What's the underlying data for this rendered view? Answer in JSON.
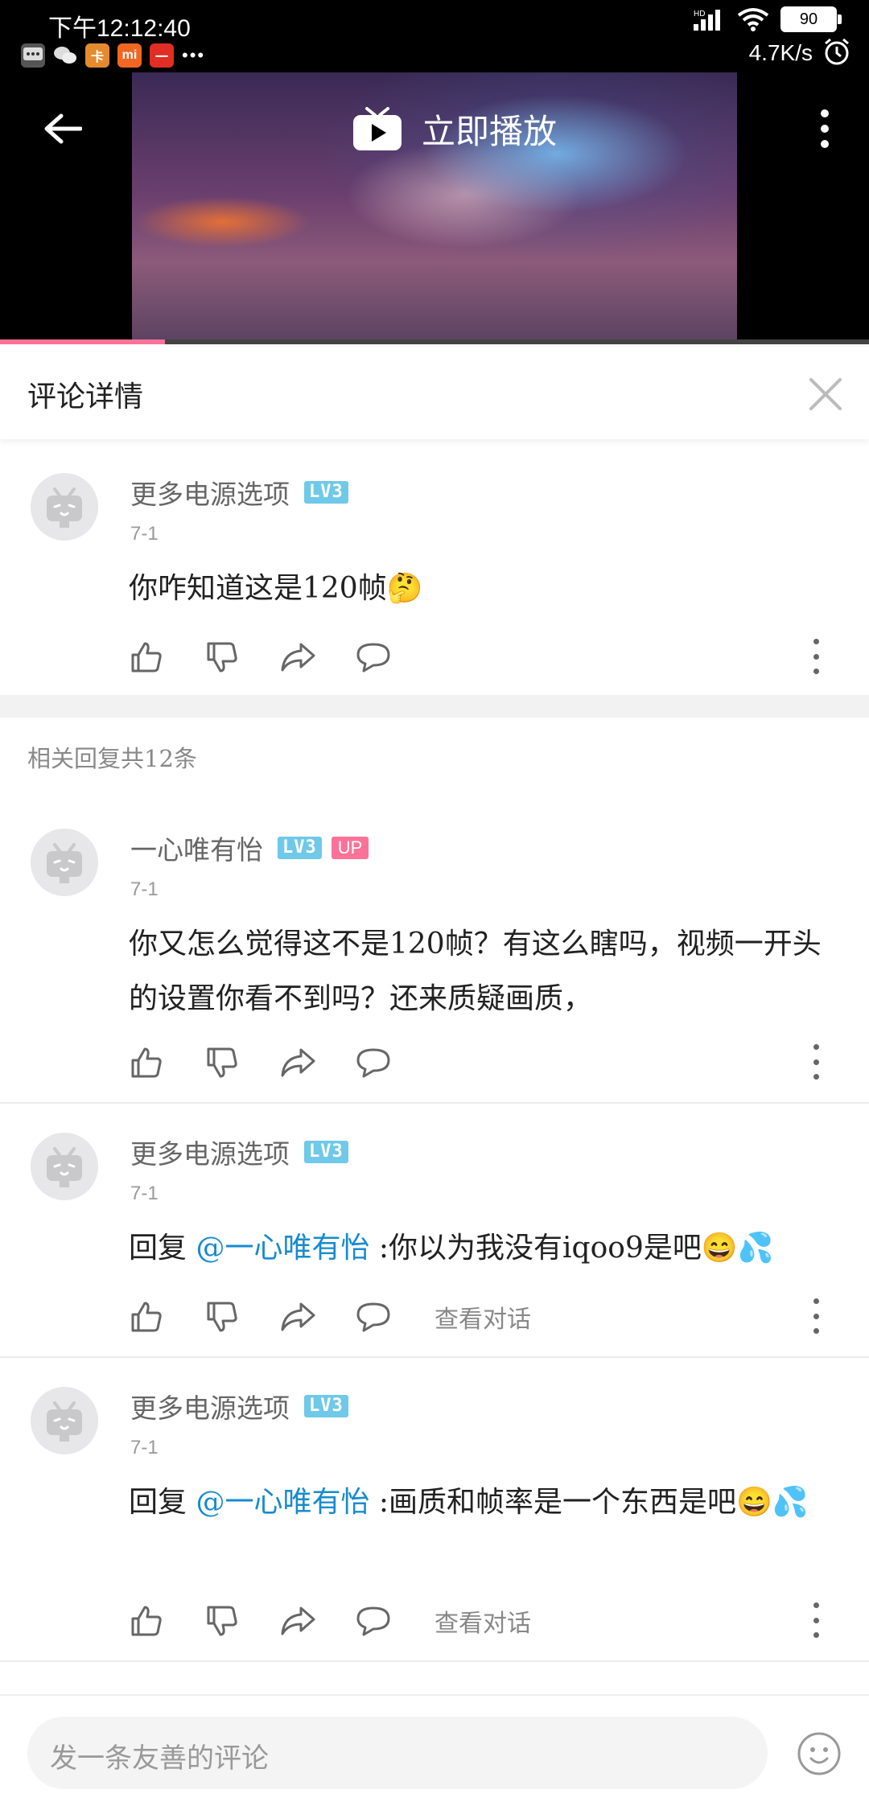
{
  "status_bar": {
    "time": "下午12:12:40",
    "speed": "4.7K/s",
    "battery": "90",
    "app_icons": [
      {
        "name": "message",
        "color": "#444444",
        "glyph": "…"
      },
      {
        "name": "wechat",
        "color": "#444444",
        "glyph": "◎"
      },
      {
        "name": "app-orange",
        "color": "#e68a2e",
        "glyph": "卡"
      },
      {
        "name": "mi",
        "color": "#f06723",
        "glyph": "mi"
      },
      {
        "name": "pinduoduo",
        "color": "#e02e24",
        "glyph": "一"
      }
    ],
    "more": "•••"
  },
  "video": {
    "play_label": "立即播放",
    "progress": 0.19
  },
  "panel": {
    "title": "评论详情"
  },
  "main_comment": {
    "user": "更多电源选项",
    "level": "LV3",
    "date": "7-1",
    "text": "你咋知道这是120帧🤔"
  },
  "related": {
    "label": "相关回复共12条"
  },
  "replies": [
    {
      "user": "一心唯有怡",
      "level": "LV3",
      "up_badge": "UP",
      "date": "7-1",
      "text": "你又怎么觉得这不是120帧？有这么瞎吗，视频一开头的设置你看不到吗？还来质疑画质，"
    },
    {
      "user": "更多电源选项",
      "level": "LV3",
      "date": "7-1",
      "reply_prefix": "回复 ",
      "mention": "@一心唯有怡",
      "text": " :你以为我没有iqoo9是吧😄💦",
      "view_conversation": "查看对话"
    },
    {
      "user": "更多电源选项",
      "level": "LV3",
      "date": "7-1",
      "reply_prefix": "回复 ",
      "mention": "@一心唯有怡",
      "text": " :画质和帧率是一个东西是吧😄💦",
      "view_conversation": "查看对话"
    }
  ],
  "input": {
    "placeholder": "发一条友善的评论"
  }
}
